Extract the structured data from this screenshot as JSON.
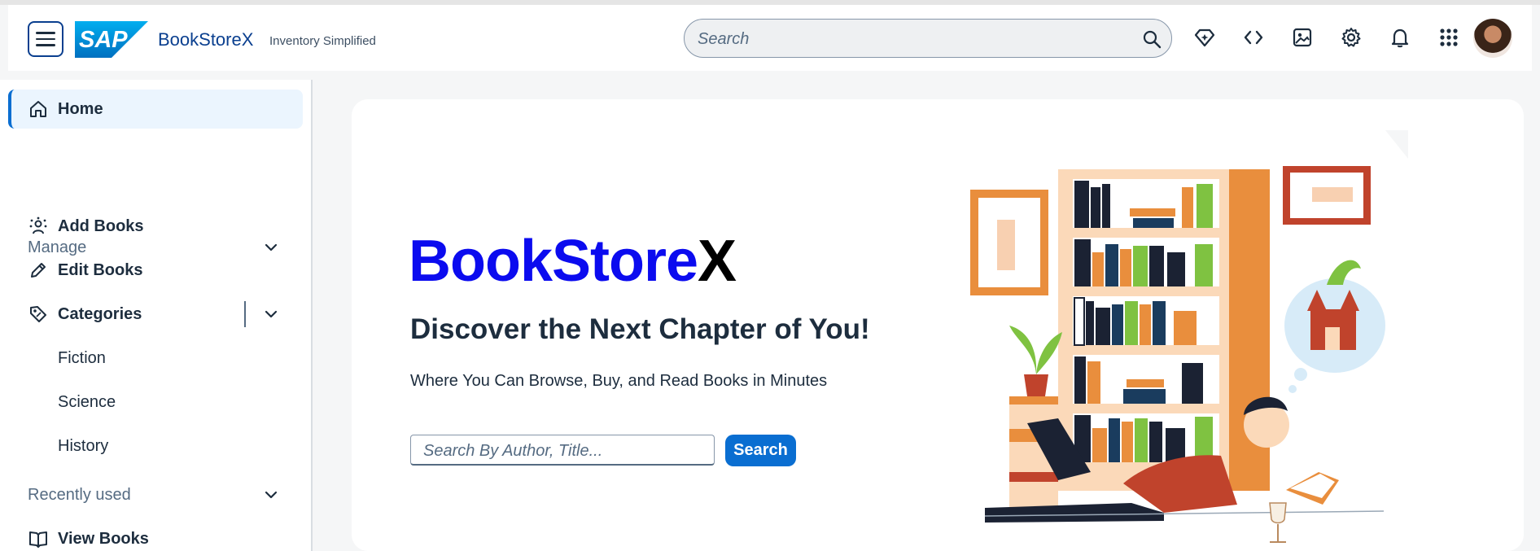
{
  "shellbar": {
    "brand_title": "BookStoreX",
    "brand_subtitle": "Inventory Simplified",
    "search_placeholder": "Search",
    "icons": [
      "menu-icon",
      "sap-logo",
      "search-icon",
      "ai-diamond-icon",
      "code-icon",
      "image-icon",
      "settings-icon",
      "bell-icon",
      "grid-icon"
    ]
  },
  "sidenav": {
    "home": "Home",
    "manage_group": "Manage",
    "add_books": "Add Books",
    "edit_books": "Edit Books",
    "categories": "Categories",
    "sub_categories": [
      "Fiction",
      "Science",
      "History"
    ],
    "recent_group": "Recently used",
    "view_books": "View Books"
  },
  "hero": {
    "title_blue": "BookStore",
    "title_black": "X",
    "subtitle": "Discover the Next Chapter of You!",
    "description": "Where You Can Browse, Buy, and Read Books in Minutes",
    "search_placeholder": "Search By Author, Title...",
    "search_button": "Search"
  },
  "colors": {
    "accent": "#0a6ed1",
    "brand_blue": "#0a3f8f",
    "title_blue": "#0b0bef"
  }
}
